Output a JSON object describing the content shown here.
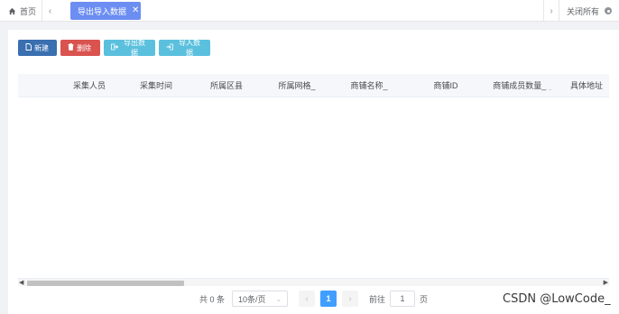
{
  "tabbar": {
    "home_label": "首页",
    "prev_arrow": "‹",
    "active_tab_label": "导出导入数据",
    "active_tab_close": "✕",
    "next_arrow": "›",
    "close_all_label": "关闭所有"
  },
  "toolbar": {
    "new_label": "新建",
    "delete_label": "删除",
    "export_label": "导出数据",
    "import_label": "导入数据"
  },
  "table": {
    "columns": [
      "采集人员",
      "采集时间",
      "所属区县",
      "所属网格_",
      "商铺名称_",
      "商铺ID",
      "商铺成员数量_",
      "具体地址"
    ],
    "rows": []
  },
  "pagination": {
    "total_text": "共 0 条",
    "page_size": "10条/页",
    "prev": "‹",
    "current_page": "1",
    "next": "›",
    "goto_label": "前往",
    "goto_value": "1",
    "goto_unit": "页"
  },
  "watermark": "CSDN @LowCode_",
  "colors": {
    "tab_active": "#6c8ef2",
    "btn_new": "#3a6fb0",
    "btn_delete": "#d9534f",
    "btn_export_import": "#5bc0de",
    "page_active": "#409eff"
  }
}
